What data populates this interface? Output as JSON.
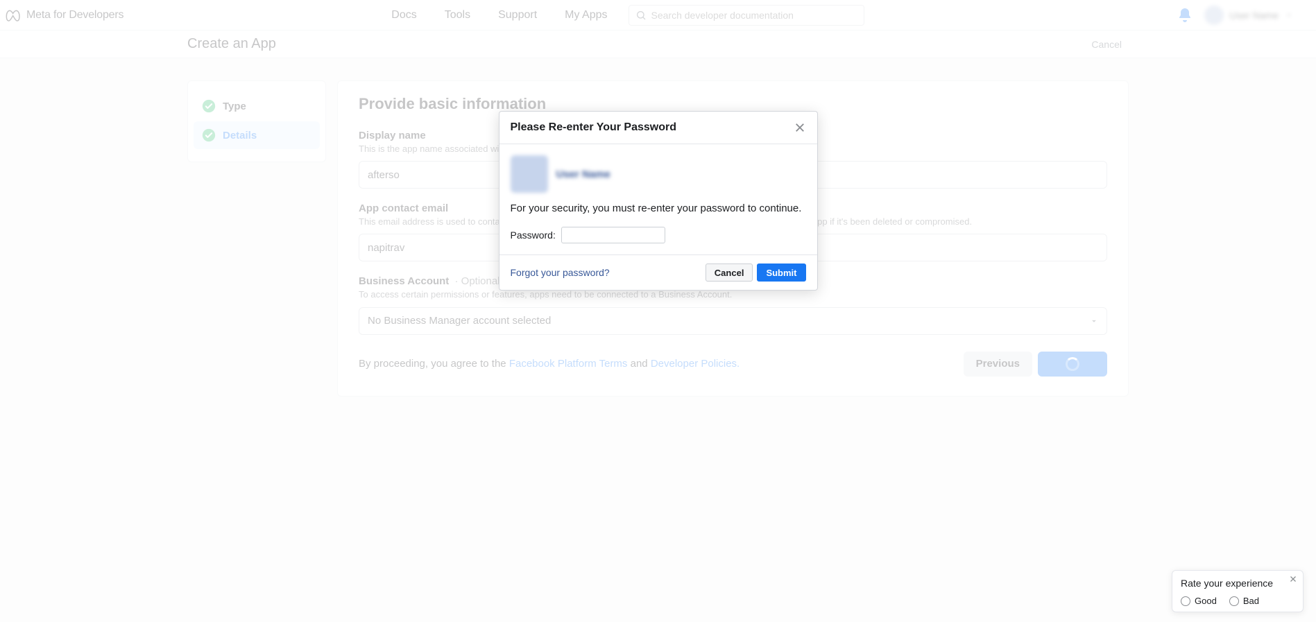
{
  "brand_text": "Meta for Developers",
  "nav": {
    "docs": "Docs",
    "tools": "Tools",
    "support": "Support",
    "my_apps": "My Apps",
    "search_placeholder": "Search developer documentation"
  },
  "topbar_user_name": "User Name",
  "subheader": {
    "title": "Create an App",
    "cancel": "Cancel"
  },
  "sidebar": {
    "items": [
      {
        "label": "Type"
      },
      {
        "label": "Details"
      }
    ]
  },
  "content": {
    "section_title": "Provide basic information",
    "display_name": {
      "label": "Display name",
      "desc": "This is the app name associated with your app ID. You can change this later.",
      "value": "afterso"
    },
    "contact_email": {
      "label": "App contact email",
      "desc": "This email address is used to contact you about potential policy violations, app restrictions or steps to recover the app if it's been deleted or compromised.",
      "value": "napitrav"
    },
    "business_account": {
      "label": "Business Account",
      "optional": "· Optional",
      "desc": "To access certain permissions or features, apps need to be connected to a Business Account.",
      "selected": "No Business Manager account selected"
    },
    "footer": {
      "agree_prefix": "By proceeding, you agree to the ",
      "platform_terms": "Facebook Platform Terms",
      "and": " and ",
      "developer_policies": "Developer Policies.",
      "previous": "Previous"
    }
  },
  "modal": {
    "title": "Please Re-enter Your Password",
    "user_name": "User Name",
    "security_text": "For your security, you must re-enter your password to continue.",
    "password_label": "Password:",
    "forgot_link": "Forgot your password?",
    "cancel": "Cancel",
    "submit": "Submit"
  },
  "feedback": {
    "title": "Rate your experience",
    "good": "Good",
    "bad": "Bad"
  }
}
